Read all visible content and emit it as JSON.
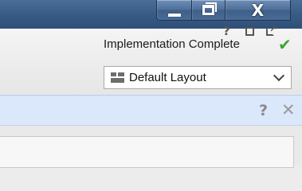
{
  "window": {
    "controls": {
      "minimize_icon": "minimize-icon",
      "maximize_icon": "restore-icon",
      "close_glyph": "X"
    }
  },
  "status": {
    "text": "Implementation Complete",
    "check_icon": "checkmark-icon",
    "check_glyph": "✔",
    "check_color": "#3fa535"
  },
  "layout_select": {
    "value": "Default Layout",
    "icon": "layout-icon"
  },
  "help_bar": {
    "help_glyph": "?",
    "close_glyph": "✕"
  },
  "panel": {
    "help_glyph": "?",
    "maximize_icon": "maximize-icon",
    "float_icon": "float-icon"
  }
}
